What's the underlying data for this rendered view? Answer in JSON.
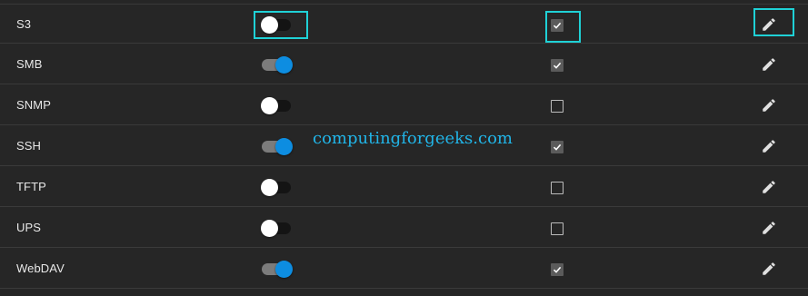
{
  "services": [
    {
      "name": "S3",
      "running": false,
      "start_automatically": true
    },
    {
      "name": "SMB",
      "running": true,
      "start_automatically": true
    },
    {
      "name": "SNMP",
      "running": false,
      "start_automatically": false
    },
    {
      "name": "SSH",
      "running": true,
      "start_automatically": true
    },
    {
      "name": "TFTP",
      "running": false,
      "start_automatically": false
    },
    {
      "name": "UPS",
      "running": false,
      "start_automatically": false
    },
    {
      "name": "WebDAV",
      "running": true,
      "start_automatically": true
    }
  ],
  "watermark": "computingforgeeks.com",
  "colors": {
    "background": "#262626",
    "toggle_on": "#0d8de1",
    "highlight": "#1fd1d6",
    "watermark": "#21b5e8"
  },
  "icons": {
    "edit": "pencil-icon",
    "check": "checkmark-icon"
  }
}
